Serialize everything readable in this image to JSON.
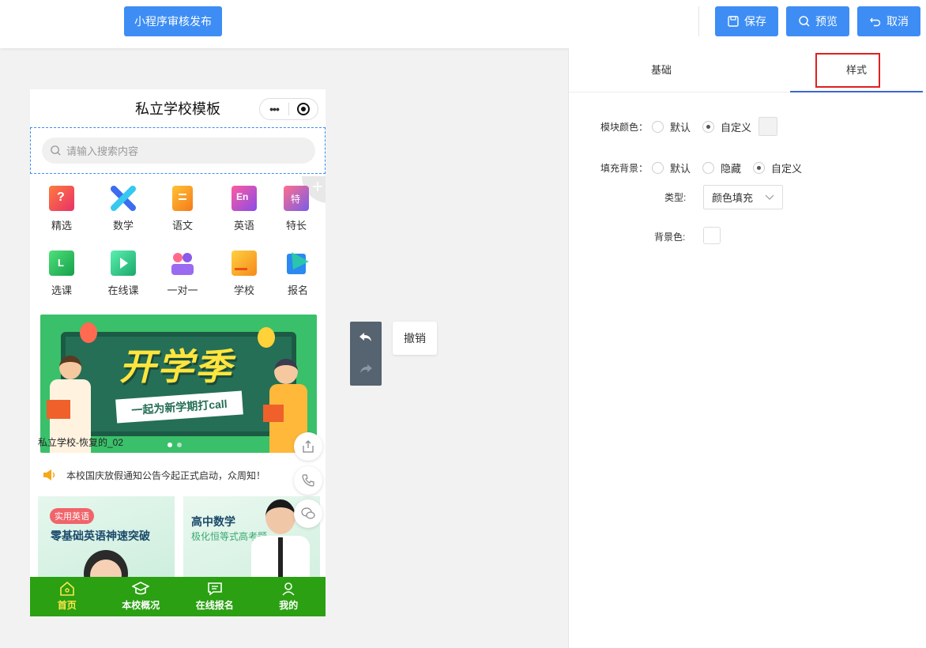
{
  "toolbar": {
    "publish_label": "小程序审核发布",
    "save_label": "保存",
    "preview_label": "预览",
    "cancel_label": "取消"
  },
  "phone": {
    "title": "私立学校模板",
    "capsule_dots": "•••",
    "search_placeholder": "请输入搜索内容",
    "grid_row1": [
      {
        "label": "精选",
        "icon": "featured-icon",
        "color": "#f0463c"
      },
      {
        "label": "数学",
        "icon": "math-icon",
        "color": "#4a6cf0"
      },
      {
        "label": "语文",
        "icon": "chinese-icon",
        "color": "#f59a1f"
      },
      {
        "label": "英语",
        "icon": "english-icon",
        "color": "#b04ce0"
      },
      {
        "label": "特长",
        "icon": "talent-icon",
        "color": "#9a6ae8"
      }
    ],
    "grid_row2": [
      {
        "label": "选课",
        "icon": "select-course-icon",
        "color": "#2fbf5a"
      },
      {
        "label": "在线课",
        "icon": "online-course-icon",
        "color": "#2fbf8a"
      },
      {
        "label": "一对一",
        "icon": "one-on-one-icon",
        "color": "#8a5ae8"
      },
      {
        "label": "学校",
        "icon": "school-icon",
        "color": "#f5a020"
      },
      {
        "label": "报名",
        "icon": "signup-icon",
        "color": "#2a9af0"
      }
    ],
    "banner": {
      "headline": "开学季",
      "ribbon": "一起为新学期打call",
      "caption": "私立学校-恢复的_02"
    },
    "notice": "本校国庆放假通知公告今起正式启动，众周知！",
    "cards": [
      {
        "tag": "实用英语",
        "title": "零基础英语神速突破"
      },
      {
        "title": "高中数学",
        "subtitle": "极化恒等式高考题"
      }
    ],
    "bottom_nav": [
      {
        "label": "首页",
        "icon": "home-icon",
        "active": true
      },
      {
        "label": "本校概况",
        "icon": "graduation-cap-icon",
        "active": false
      },
      {
        "label": "在线报名",
        "icon": "message-icon",
        "active": false
      },
      {
        "label": "我的",
        "icon": "user-icon",
        "active": false
      }
    ]
  },
  "undo": {
    "tooltip": "撤销"
  },
  "panel": {
    "tabs": [
      "基础",
      "样式"
    ],
    "active_tab": "样式",
    "module_color_label": "模块颜色：",
    "module_color_options": [
      "默认",
      "自定义"
    ],
    "module_color_selected": "自定义",
    "fill_bg_label": "填充背景：",
    "fill_bg_options": [
      "默认",
      "隐藏",
      "自定义"
    ],
    "fill_bg_selected": "自定义",
    "type_label": "类型:",
    "type_value": "颜色填充",
    "bg_color_label": "背景色:"
  },
  "colors": {
    "accent": "#3d8df5",
    "nav_green": "#2aa012",
    "tab_underline": "#3d66d8",
    "highlight_red": "#e02020"
  }
}
